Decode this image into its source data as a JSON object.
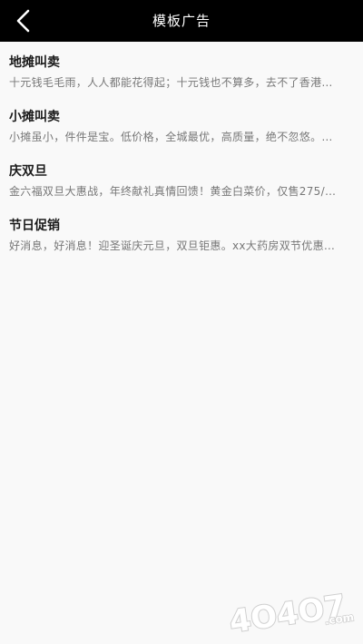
{
  "header": {
    "title": "模板广告",
    "back_icon": "chevron-left-icon"
  },
  "templates": [
    {
      "title": "地摊叫卖",
      "desc": "十元钱毛毛雨，人人都能花得起；十元钱也不算多，去不了香港…"
    },
    {
      "title": "小摊叫卖",
      "desc": "小摊虽小，件件是宝。低价格，全城最优，高质量，绝不忽悠。…"
    },
    {
      "title": "庆双旦",
      "desc": "金六福双旦大惠战，年终献礼真情回馈！黄金白菜价，仅售275/…"
    },
    {
      "title": "节日促销",
      "desc": "好消息，好消息！迎圣诞庆元旦，双旦钜惠。xx大药房双节优惠…"
    }
  ],
  "watermark": {
    "text": "4O4O7",
    "suffix": ".com"
  },
  "colors": {
    "header_bg": "#000000",
    "page_bg": "#f9f9f9",
    "title_text": "#1a1a1a",
    "desc_text": "#777777"
  }
}
